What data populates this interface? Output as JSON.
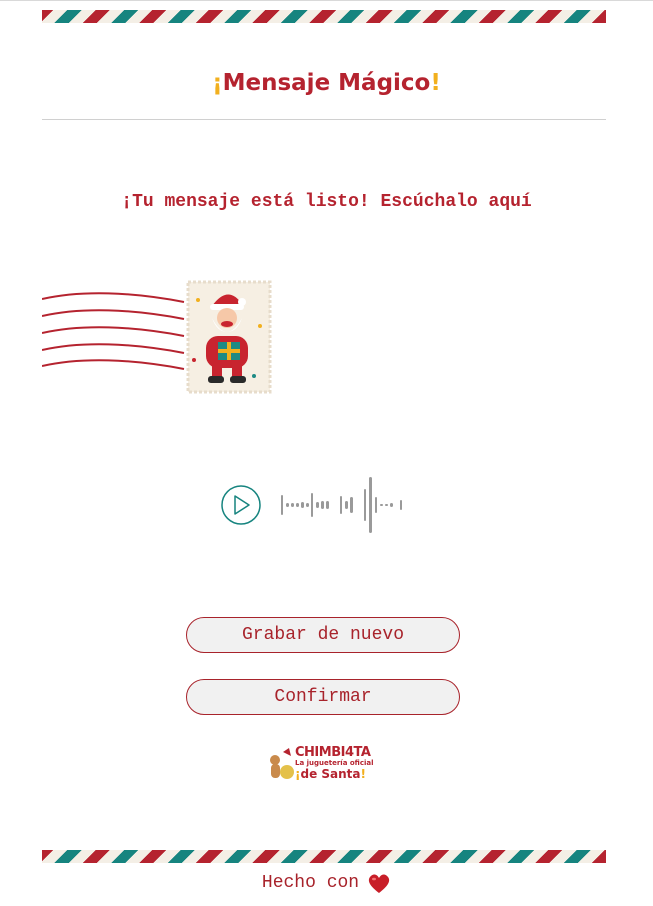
{
  "header": {
    "title_open": "¡",
    "title_main": "Mensaje Mágico",
    "title_close": "!"
  },
  "message": {
    "status": "¡Tu mensaje está listo! Escúchalo aquí"
  },
  "player": {
    "play_icon": "play-circle-icon",
    "waveform_icon": "waveform-icon"
  },
  "actions": {
    "record_again_label": "Grabar de nuevo",
    "confirm_label": "Confirmar"
  },
  "brand": {
    "line1": "CHIMBI4TA",
    "line2": "La juguetería oficial",
    "line3_open": "¡",
    "line3": "de Santa",
    "line3_close": "!"
  },
  "footer": {
    "made_with": "Hecho con",
    "heart_icon": "heart-icon"
  },
  "colors": {
    "primary": "#b5232f",
    "accent_yellow": "#f2b01e",
    "teal": "#16847f",
    "cream": "#f4efe6"
  }
}
